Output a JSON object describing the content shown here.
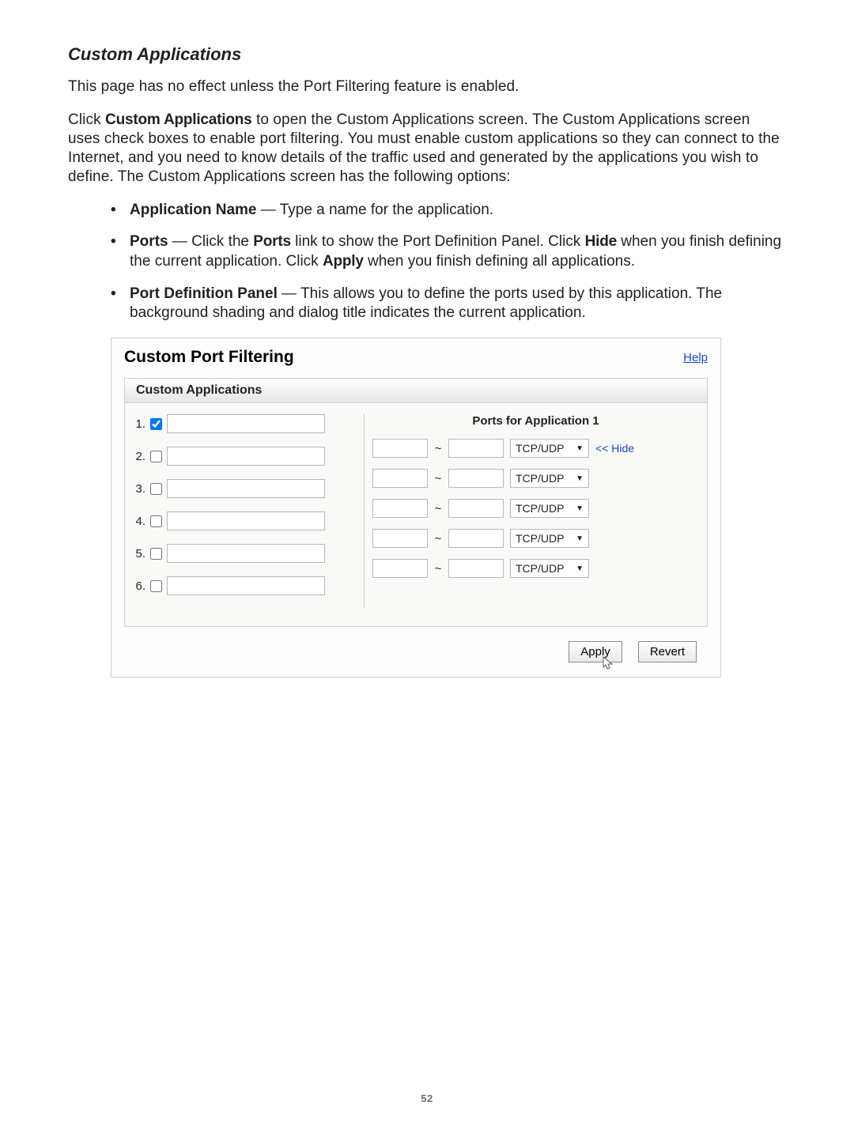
{
  "heading": "Custom Applications",
  "intro": "This page has no effect unless the Port Filtering feature is enabled.",
  "p2_a": "Click ",
  "p2_bold": "Custom Applications",
  "p2_b": " to open the Custom Applications screen. The Custom Applications screen uses check boxes to enable port filtering. You must enable custom applications so they can connect to the Internet, and you need to know details of the traffic used and generated by the applications you wish to define. The Custom Applications screen has the following options:",
  "bullets": [
    {
      "bold": "Application Name",
      "rest": " — Type a name for the application."
    },
    {
      "bold": "Ports",
      "rest_a": " — Click the ",
      "inline1": "Ports",
      "rest_b": " link to show the Port Definition Panel. Click ",
      "inline2": "Hide",
      "rest_c": " when you finish defining the current application. Click ",
      "inline3": "Apply",
      "rest_d": " when you finish defining all applications."
    },
    {
      "bold": "Port Definition Panel",
      "rest": " — This allows you to define the ports used by this application. The background shading and dialog title indicates the current application."
    }
  ],
  "panel": {
    "title": "Custom Port Filtering",
    "help": "Help",
    "subheader": "Custom Applications",
    "apps": [
      {
        "num": "1.",
        "checked": true
      },
      {
        "num": "2.",
        "checked": false
      },
      {
        "num": "3.",
        "checked": false
      },
      {
        "num": "4.",
        "checked": false
      },
      {
        "num": "5.",
        "checked": false
      },
      {
        "num": "6.",
        "checked": false
      }
    ],
    "ports_title": "Ports for Application 1",
    "tilde": "~",
    "protocol": "TCP/UDP",
    "hide": "<< Hide",
    "apply": "Apply",
    "revert": "Revert"
  },
  "page_number": "52"
}
